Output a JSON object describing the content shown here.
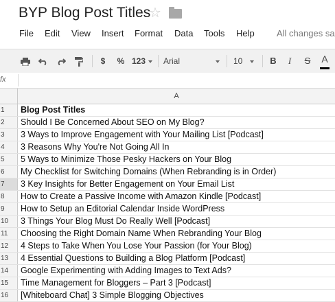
{
  "doc": {
    "title": "BYP Blog Post Titles"
  },
  "menu": {
    "items": [
      "File",
      "Edit",
      "View",
      "Insert",
      "Format",
      "Data",
      "Tools",
      "Help"
    ],
    "save_status": "All changes sa"
  },
  "toolbar": {
    "currency": "$",
    "percent": "%",
    "number_format": "123",
    "font": "Arial",
    "font_size": "10",
    "bold": "B",
    "italic": "I",
    "strikethrough": "S",
    "text_color": "A",
    "text_color_swatch": "#000000"
  },
  "formula_bar": {
    "label": "fx",
    "value": ""
  },
  "grid": {
    "column_header": "A",
    "rows": [
      {
        "num": "1",
        "text": "Blog Post Titles"
      },
      {
        "num": "2",
        "text": "Should I Be Concerned About SEO on My Blog?"
      },
      {
        "num": "3",
        "text": "3 Ways to Improve Engagement with Your Mailing List [Podcast]"
      },
      {
        "num": "4",
        "text": "3 Reasons Why You're Not Going All In"
      },
      {
        "num": "5",
        "text": "5 Ways to Minimize Those Pesky Hackers on Your Blog"
      },
      {
        "num": "6",
        "text": "My Checklist for Switching Domains (When Rebranding is in Order)"
      },
      {
        "num": "7",
        "text": "3 Key Insights for Better Engagement on Your Email List"
      },
      {
        "num": "8",
        "text": "How to Create a Passive Income with Amazon Kindle [Podcast]"
      },
      {
        "num": "9",
        "text": "How to Setup an Editorial Calendar Inside WordPress"
      },
      {
        "num": "10",
        "text": "3 Things Your Blog Must Do Really Well [Podcast]"
      },
      {
        "num": "11",
        "text": "Choosing the Right Domain Name When Rebranding Your Blog"
      },
      {
        "num": "12",
        "text": "4 Steps to Take When You Lose Your Passion (for Your Blog)"
      },
      {
        "num": "13",
        "text": "4 Essential Questions to Building a Blog Platform [Podcast]"
      },
      {
        "num": "14",
        "text": "Google Experimenting with Adding Images to Text Ads?"
      },
      {
        "num": "15",
        "text": "Time Management for Bloggers – Part 3 [Podcast]"
      },
      {
        "num": "16",
        "text": "[Whiteboard Chat] 3 Simple Blogging Objectives"
      }
    ]
  }
}
